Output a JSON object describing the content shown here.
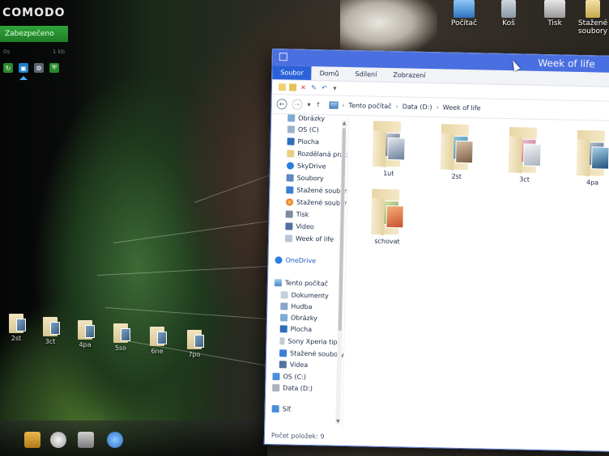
{
  "desktop": {
    "comodo": {
      "logo": "COMODO",
      "status": "Zabezpečeno",
      "stat_left": "0s",
      "stat_right": "1 kb"
    },
    "top_icons": [
      {
        "label": "Počítač",
        "icon": "computer-icon"
      },
      {
        "label": "Koš",
        "icon": "recycle-bin-icon"
      },
      {
        "label": "Tisk",
        "icon": "printer-icon"
      },
      {
        "label": "Stažené soubory",
        "icon": "downloads-icon"
      }
    ],
    "folders": [
      "2st",
      "3ct",
      "4pa",
      "5so",
      "6ne",
      "7po"
    ]
  },
  "window": {
    "title": "Week of life",
    "ribbon_tabs": [
      "Soubor",
      "Domů",
      "Sdílení",
      "Zobrazení"
    ],
    "address": {
      "crumbs": [
        "Tento počítač",
        "Data (D:)",
        "Week of life"
      ]
    },
    "nav_pane": {
      "quick_access": [
        {
          "label": "Obrázky",
          "icon": "pictures-icon"
        },
        {
          "label": "OS (C)",
          "icon": "drive-icon"
        },
        {
          "label": "Plocha",
          "icon": "desktop-icon"
        },
        {
          "label": "Rozdělaná práce",
          "icon": "folder-icon"
        },
        {
          "label": "SkyDrive",
          "icon": "cloud-icon"
        },
        {
          "label": "Soubory",
          "icon": "files-icon"
        },
        {
          "label": "Stažené soubory",
          "icon": "downloads-icon"
        },
        {
          "label": "Stažené soubory",
          "icon": "chrome-downloads-icon"
        },
        {
          "label": "Tisk",
          "icon": "printer-icon"
        },
        {
          "label": "Video",
          "icon": "video-icon"
        },
        {
          "label": "Week of life",
          "icon": "folder-icon"
        }
      ],
      "onedrive": "OneDrive",
      "this_pc": "Tento počítač",
      "this_pc_items": [
        {
          "label": "Dokumenty",
          "icon": "documents-icon"
        },
        {
          "label": "Hudba",
          "icon": "music-icon"
        },
        {
          "label": "Obrázky",
          "icon": "pictures-icon"
        },
        {
          "label": "Plocha",
          "icon": "desktop-icon"
        },
        {
          "label": "Sony Xperia tipo",
          "icon": "phone-icon"
        },
        {
          "label": "Stažené soubory",
          "icon": "downloads-icon"
        },
        {
          "label": "Videa",
          "icon": "video-icon"
        },
        {
          "label": "OS (C:)",
          "icon": "drive-icon"
        },
        {
          "label": "Data (D:)",
          "icon": "drive-icon"
        }
      ],
      "network": "Síť"
    },
    "content": {
      "folders": [
        {
          "name": "1ut"
        },
        {
          "name": "2st"
        },
        {
          "name": "3ct"
        },
        {
          "name": "4pa"
        },
        {
          "name": "schovat"
        }
      ]
    },
    "status": "Počet položek: 9"
  },
  "colors": {
    "titlebar": "#4a6fe0",
    "ribbon_active": "#2c62d9",
    "comodo_green": "#2fa538"
  }
}
